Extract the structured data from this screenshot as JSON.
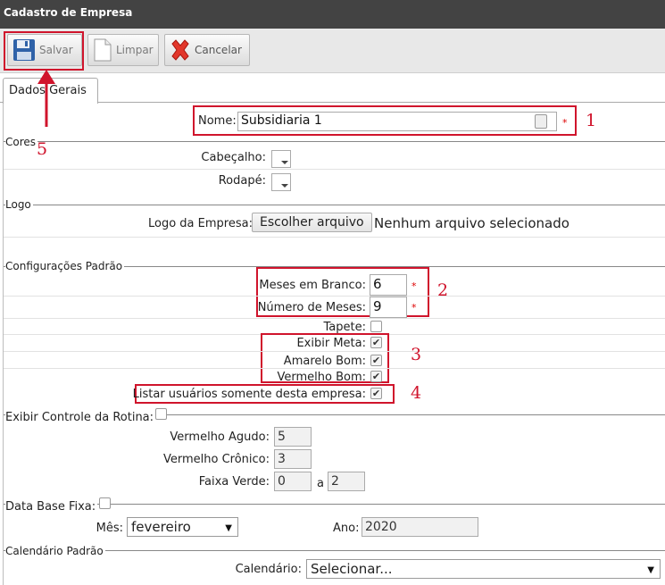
{
  "window": {
    "title": "Cadastro de Empresa"
  },
  "toolbar": {
    "save": "Salvar",
    "clear": "Limpar",
    "cancel": "Cancelar"
  },
  "tabs": [
    "Dados Gerais"
  ],
  "form": {
    "nome": {
      "label": "Nome:",
      "value": "Subsidiaria 1",
      "required": "*"
    },
    "cores": {
      "legend": "Cores",
      "header_label": "Cabeçalho:",
      "footer_label": "Rodapé:"
    },
    "logo": {
      "legend": "Logo",
      "label": "Logo da Empresa:",
      "button": "Escolher arquivo",
      "status": "Nenhum arquivo selecionado"
    },
    "config": {
      "legend": "Configurações Padrão",
      "meses_branco": {
        "label": "Meses em Branco:",
        "value": "6",
        "required": "*"
      },
      "numero_meses": {
        "label": "Número de Meses:",
        "value": "9",
        "required": "*"
      },
      "tapete": {
        "label": "Tapete:",
        "checked": false
      },
      "exibir_meta": {
        "label": "Exibir Meta:",
        "checked": true
      },
      "amarelo_bom": {
        "label": "Amarelo Bom:",
        "checked": true
      },
      "vermelho_bom": {
        "label": "Vermelho Bom:",
        "checked": true
      },
      "listar_usuarios": {
        "label": "Listar usuários somente desta empresa:",
        "checked": true
      }
    },
    "rotina": {
      "legend": "Exibir Controle da Rotina:",
      "vermelho_agudo": {
        "label": "Vermelho Agudo:",
        "value": "5"
      },
      "vermelho_cronico": {
        "label": "Vermelho Crônico:",
        "value": "3"
      },
      "faixa_verde": {
        "label": "Faixa Verde:",
        "from": "0",
        "sep": "a",
        "to": "2"
      }
    },
    "data_base": {
      "legend": "Data Base Fixa:",
      "mes": {
        "label": "Mês:",
        "value": "fevereiro"
      },
      "ano": {
        "label": "Ano:",
        "value": "2020"
      }
    },
    "calendario": {
      "legend": "Calendário Padrão",
      "label": "Calendário:",
      "value": "Selecionar..."
    }
  },
  "annotations": {
    "n1": "1",
    "n2": "2",
    "n3": "3",
    "n4": "4",
    "n5": "5"
  },
  "colors": {
    "annotation": "#d0142c",
    "titlebar": "#434343"
  }
}
